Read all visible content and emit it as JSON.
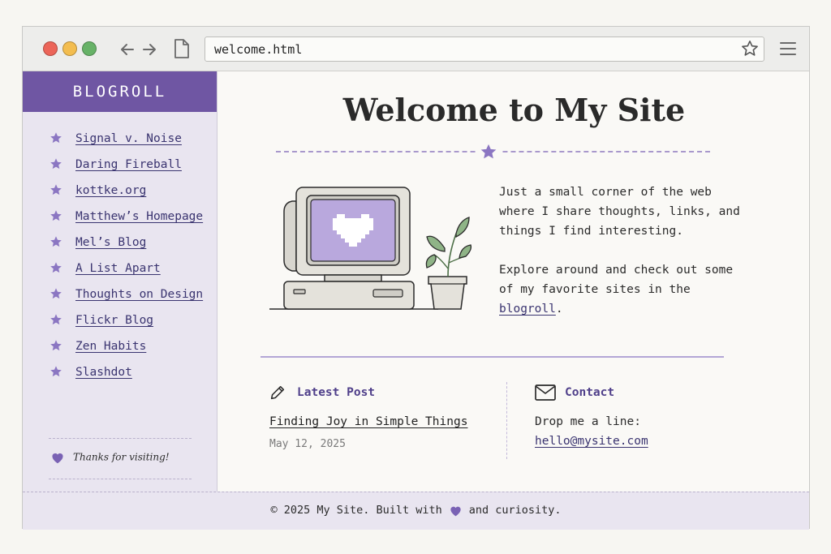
{
  "browser": {
    "url": "welcome.html",
    "back_icon": "arrow-left-icon",
    "forward_icon": "arrow-right-icon",
    "page_icon": "document-icon",
    "bookmark_icon": "star-outline-icon",
    "menu_icon": "hamburger-menu-icon"
  },
  "sidebar": {
    "heading": "BLOGROLL",
    "items": [
      {
        "label": "Signal v. Noise"
      },
      {
        "label": "Daring Fireball"
      },
      {
        "label": "kottke.org"
      },
      {
        "label": "Matthew’s Homepage"
      },
      {
        "label": "Mel’s Blog"
      },
      {
        "label": "A List Apart"
      },
      {
        "label": "Thoughts on Design"
      },
      {
        "label": "Flickr Blog"
      },
      {
        "label": "Zen Habits"
      },
      {
        "label": "Slashdot"
      }
    ],
    "thanks": "Thanks for visiting!"
  },
  "main": {
    "title": "Welcome to My Site",
    "intro_1": "Just a small corner of the web where I share thoughts, links, and things I find interesting.",
    "intro_2_prefix": "Explore around and check out some of my favorite sites in the ",
    "intro_2_link": "blogroll",
    "intro_2_suffix": "."
  },
  "latest_post": {
    "heading": "Latest Post",
    "title": "Finding Joy in Simple Things",
    "date": "May 12, 2025"
  },
  "contact": {
    "heading": "Contact",
    "text": "Drop me a line:",
    "email": "hello@mysite.com"
  },
  "footer": {
    "prefix": "© 2025 My Site. Built with",
    "suffix": "and curiosity."
  },
  "colors": {
    "accent": "#6f56a3",
    "sidebar_bg": "#e9e5f0",
    "window_bg": "#faf9f6",
    "screen": "#b9a8dd"
  }
}
